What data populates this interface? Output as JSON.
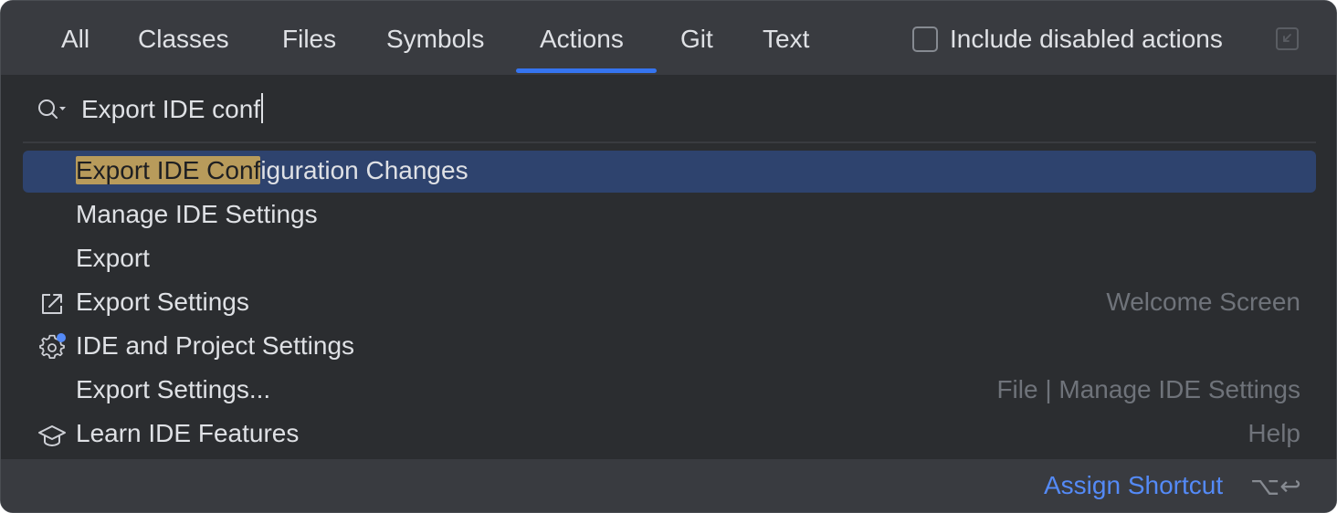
{
  "tabs": [
    {
      "label": "All",
      "selected": false
    },
    {
      "label": "Classes",
      "selected": false
    },
    {
      "label": "Files",
      "selected": false
    },
    {
      "label": "Symbols",
      "selected": false
    },
    {
      "label": "Actions",
      "selected": true
    },
    {
      "label": "Git",
      "selected": false
    },
    {
      "label": "Text",
      "selected": false
    }
  ],
  "include_disabled": {
    "label": "Include disabled actions",
    "checked": false
  },
  "search": {
    "value": "Export IDE conf",
    "icon": "search-icon"
  },
  "results": [
    {
      "label_match": "Export IDE Conf",
      "label_rest": "iguration Changes",
      "hint": "",
      "icon": "",
      "selected": true
    },
    {
      "label": "Manage IDE Settings",
      "hint": "",
      "icon": ""
    },
    {
      "label": "Export",
      "hint": "",
      "icon": ""
    },
    {
      "label": "Export Settings",
      "hint": "Welcome Screen",
      "icon": "export-arrow-icon"
    },
    {
      "label": "IDE and Project Settings",
      "hint": "",
      "icon": "gear-icon"
    },
    {
      "label": "Export Settings...",
      "hint": "File | Manage IDE Settings",
      "icon": ""
    },
    {
      "label": "Learn IDE Features",
      "hint": "Help",
      "icon": "graduation-cap-icon"
    }
  ],
  "footer": {
    "assign_label": "Assign Shortcut",
    "shortcut": "⌥↩"
  },
  "colors": {
    "accent": "#3574f0",
    "link": "#548af7",
    "selection": "#2e436e",
    "match_highlight": "#b89b5b"
  }
}
